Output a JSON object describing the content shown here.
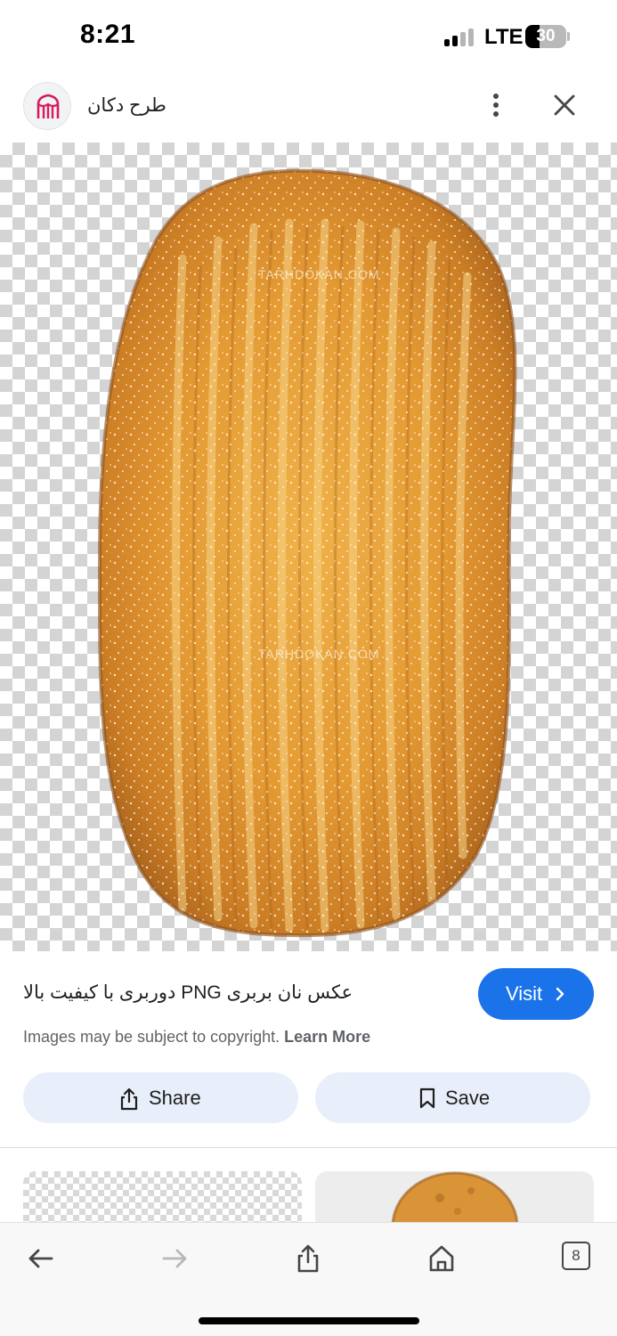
{
  "status_bar": {
    "time": "8:21",
    "network": "LTE",
    "battery": "30"
  },
  "header": {
    "site_name": "طرح دکان",
    "logo_icon": "store-icon",
    "more_icon": "more-vert-icon",
    "close_icon": "close-icon"
  },
  "image": {
    "alt_subject": "bread",
    "watermark": "TARHDOKAN.COM"
  },
  "result": {
    "title": "عکس نان بربری PNG دوربری با کیفیت بالا",
    "visit_label": "Visit",
    "copyright_text": "Images may be subject to copyright.",
    "learn_more": "Learn More"
  },
  "actions": {
    "share_label": "Share",
    "save_label": "Save"
  },
  "toolbar": {
    "tab_count": "8"
  },
  "colors": {
    "accent": "#1a73e8",
    "action_bg": "#e8eefa",
    "logo_accent": "#d81b60"
  }
}
